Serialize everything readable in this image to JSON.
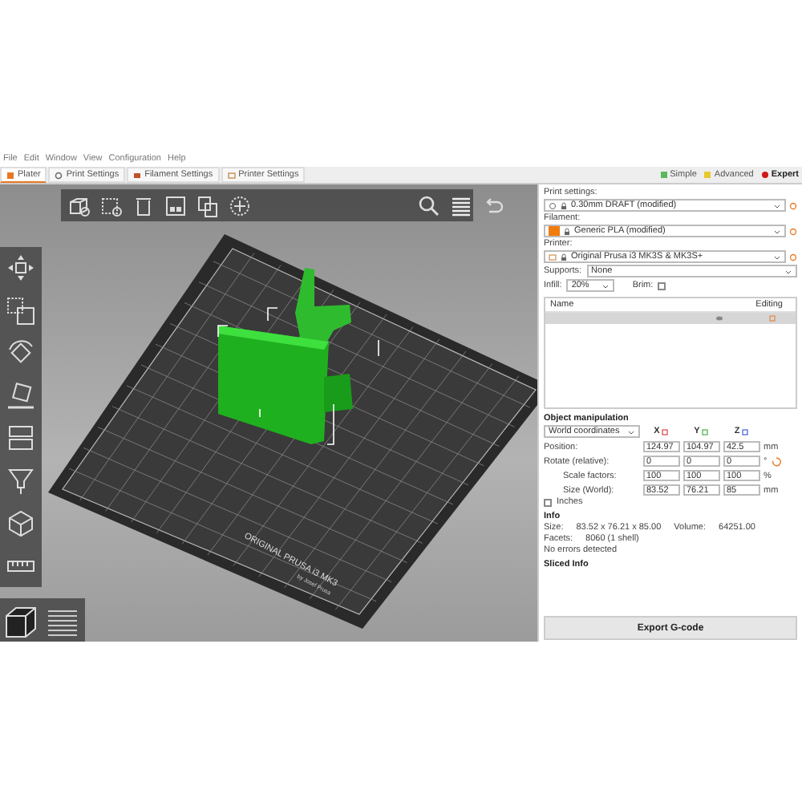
{
  "menu": [
    "File",
    "Edit",
    "Window",
    "View",
    "Configuration",
    "Help"
  ],
  "tabs": [
    {
      "label": "Plater",
      "selected": true
    },
    {
      "label": "Print Settings",
      "selected": false
    },
    {
      "label": "Filament Settings",
      "selected": false
    },
    {
      "label": "Printer Settings",
      "selected": false
    }
  ],
  "modes": [
    {
      "label": "Simple",
      "color": "#5cb85c",
      "selected": false
    },
    {
      "label": "Advanced",
      "color": "#e8c830",
      "selected": false
    },
    {
      "label": "Expert",
      "color": "#d01818",
      "selected": true
    }
  ],
  "presets": [
    {
      "label": "Print settings:",
      "value": "0.30mm DRAFT (modified)"
    },
    {
      "label": "Filament:",
      "value": "Generic PLA (modified)",
      "color": "#f07c10"
    },
    {
      "label": "Printer:",
      "value": "Original Prusa i3 MK3S & MK3S+"
    }
  ],
  "supports": {
    "label": "Supports:",
    "value": "None"
  },
  "infill": {
    "label": "Infill:",
    "value": "20%"
  },
  "brim": {
    "label": "Brim:",
    "checked": false
  },
  "object_list": {
    "columns": [
      "Name",
      "Editing"
    ],
    "rows": [
      {
        "selected": true
      }
    ]
  },
  "manipulation": {
    "title": "Object manipulation",
    "coordinates": "World coordinates",
    "axes": [
      "X",
      "Y",
      "Z"
    ],
    "rows": [
      {
        "label": "Position:",
        "values": [
          "124.97",
          "104.97",
          "42.5"
        ],
        "unit": "mm"
      },
      {
        "label": "Rotate (relative):",
        "values": [
          "0",
          "0",
          "0"
        ],
        "unit": "°"
      },
      {
        "label": "Scale factors:",
        "values": [
          "100",
          "100",
          "100"
        ],
        "unit": "%"
      },
      {
        "label": "Size (World):",
        "values": [
          "83.52",
          "76.21",
          "85"
        ],
        "unit": "mm"
      }
    ],
    "inches": {
      "label": "Inches",
      "checked": false
    }
  },
  "info": {
    "title": "Info",
    "lines": [
      [
        "Size:",
        "83.52 x 76.21 x 85.00",
        "Volume:",
        "64251.00"
      ],
      [
        "Facets:",
        "8060 (1 shell)"
      ],
      [
        "No errors detected"
      ]
    ]
  },
  "sliced_info": {
    "title": "Sliced Info"
  },
  "export_button": "Export G-code",
  "viewport": {
    "bed_label": "ORIGINAL PRUSA i3 MK3",
    "bed_sublabel": "by Josef Prusa"
  }
}
